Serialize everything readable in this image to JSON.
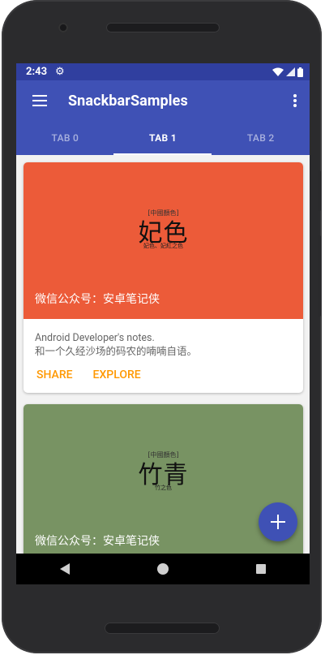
{
  "status_bar": {
    "time": "2:43"
  },
  "app_bar": {
    "title": "SnackbarSamples"
  },
  "tabs": [
    {
      "label": "TAB 0",
      "active": false
    },
    {
      "label": "TAB 1",
      "active": true
    },
    {
      "label": "TAB 2",
      "active": false
    }
  ],
  "cards": [
    {
      "color": "#ec5b39",
      "seal": "[中國顏色]",
      "hero_title": "妃色",
      "hero_subtitle": "妃色、妃紅之色",
      "caption": "微信公众号：安卓笔记侠",
      "line1": "Android Developer's notes.",
      "line2": "和一个久经沙场的码农的喃喃自语。",
      "share_label": "SHARE",
      "explore_label": "EXPLORE"
    },
    {
      "color": "#789363",
      "seal": "[中國顏色]",
      "hero_title": "竹青",
      "hero_subtitle": "竹之色",
      "caption": "微信公众号：安卓笔记侠"
    }
  ],
  "colors": {
    "primary": "#3f51b5",
    "primary_dark": "#303f9f",
    "accent": "#ff9800"
  },
  "icons": [
    "menu-icon",
    "more-vert-icon",
    "settings-icon",
    "wifi-icon",
    "signal-icon",
    "battery-icon",
    "add-icon",
    "nav-back-icon",
    "nav-home-icon",
    "nav-recents-icon"
  ]
}
